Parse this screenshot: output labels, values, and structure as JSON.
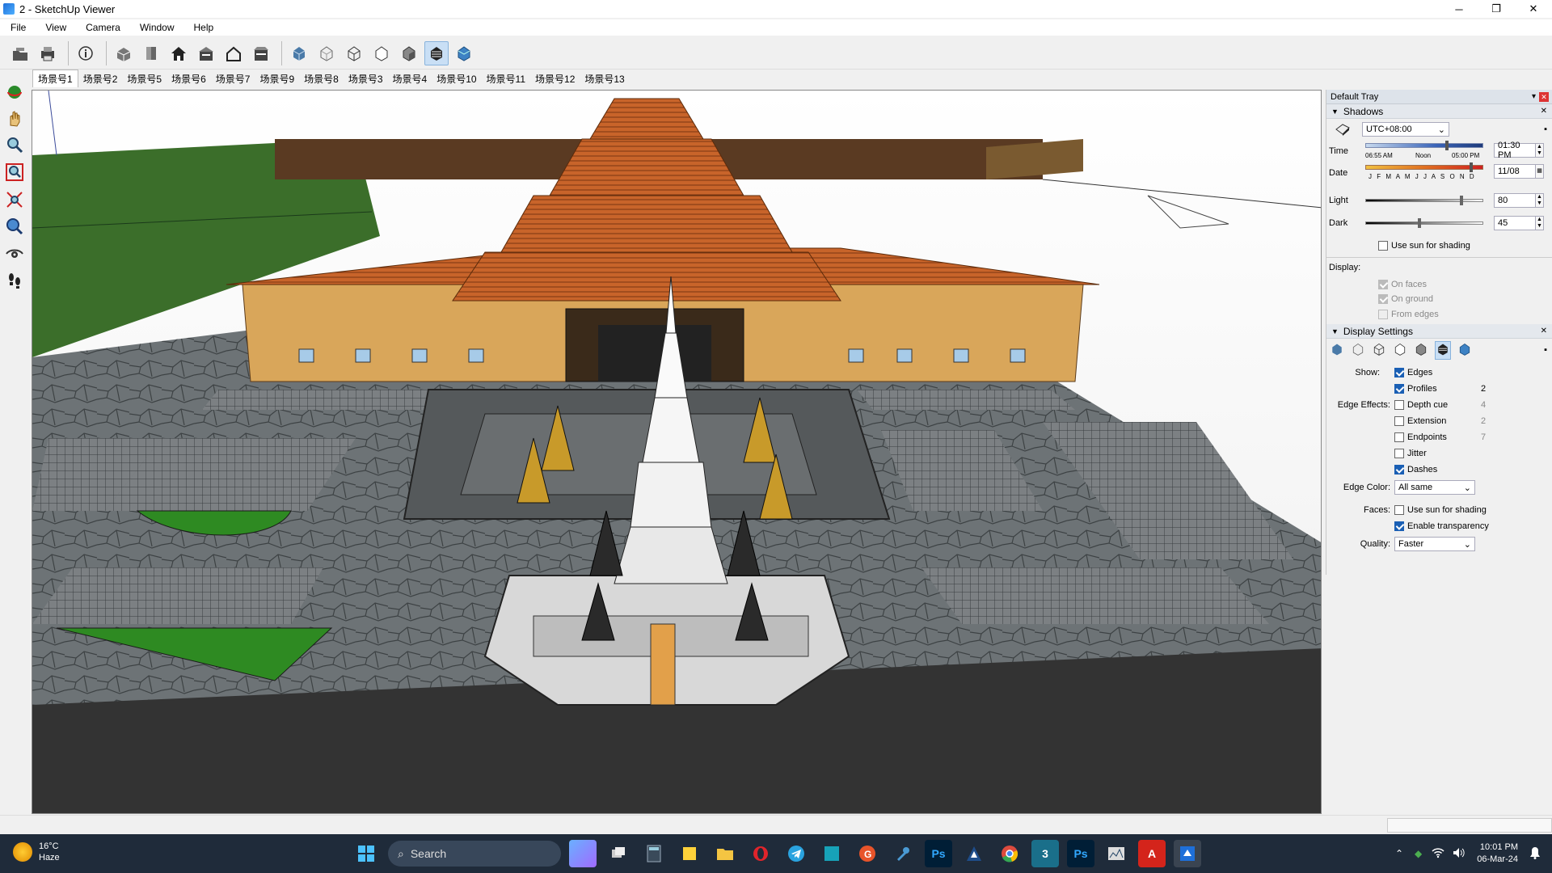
{
  "window": {
    "title": "2 - SketchUp Viewer",
    "minimize": "─",
    "maximize": "❐",
    "close": "✕"
  },
  "menu": [
    "File",
    "View",
    "Camera",
    "Window",
    "Help"
  ],
  "toolbar": {
    "icons": [
      "open-file-icon",
      "print-icon",
      "model-info-icon",
      "iso-view-icon",
      "top-view-icon",
      "front-view-icon",
      "right-view-icon",
      "back-view-icon",
      "left-view-icon",
      "xray-style-icon",
      "wireframe-style-icon",
      "hidden-line-style-icon",
      "shaded-style-icon",
      "shaded-textures-style-icon",
      "monochrome-style-icon"
    ],
    "active_index": 13
  },
  "scenes": [
    "场景号1",
    "场景号2",
    "场景号5",
    "场景号6",
    "场景号7",
    "场景号9",
    "场景号8",
    "场景号3",
    "场景号4",
    "场景号10",
    "场景号11",
    "场景号12",
    "场景号13"
  ],
  "left_tools": [
    "orbit-icon",
    "pan-icon",
    "zoom-icon",
    "zoom-window-icon",
    "zoom-extents-icon",
    "position-camera-icon",
    "look-around-icon",
    "walk-icon"
  ],
  "tray": {
    "title": "Default Tray",
    "shadows": {
      "title": "Shadows",
      "timezone": "UTC+08:00",
      "time_label": "Time",
      "time_start": "06:55 AM",
      "time_noon": "Noon",
      "time_end": "05:00 PM",
      "time_value": "01:30 PM",
      "date_label": "Date",
      "months": "J F M A M J J A S O N D",
      "date_value": "11/08",
      "light_label": "Light",
      "light_value": "80",
      "dark_label": "Dark",
      "dark_value": "45",
      "use_sun": "Use sun for shading",
      "display_label": "Display:",
      "on_faces": "On faces",
      "on_ground": "On ground",
      "from_edges": "From edges"
    },
    "display_settings": {
      "title": "Display Settings",
      "show_label": "Show:",
      "edges": "Edges",
      "profiles": "Profiles",
      "profiles_value": "2",
      "edge_effects_label": "Edge Effects:",
      "depth_cue": "Depth cue",
      "depth_cue_value": "4",
      "extension": "Extension",
      "extension_value": "2",
      "endpoints": "Endpoints",
      "endpoints_value": "7",
      "jitter": "Jitter",
      "dashes": "Dashes",
      "edge_color_label": "Edge Color:",
      "edge_color_value": "All same",
      "faces_label": "Faces:",
      "faces_use_sun": "Use sun for shading",
      "enable_transparency": "Enable transparency",
      "quality_label": "Quality:",
      "quality_value": "Faster"
    }
  },
  "taskbar": {
    "temperature": "16°C",
    "condition": "Haze",
    "search_placeholder": "Search",
    "time": "10:01 PM",
    "date": "06-Mar-24"
  }
}
